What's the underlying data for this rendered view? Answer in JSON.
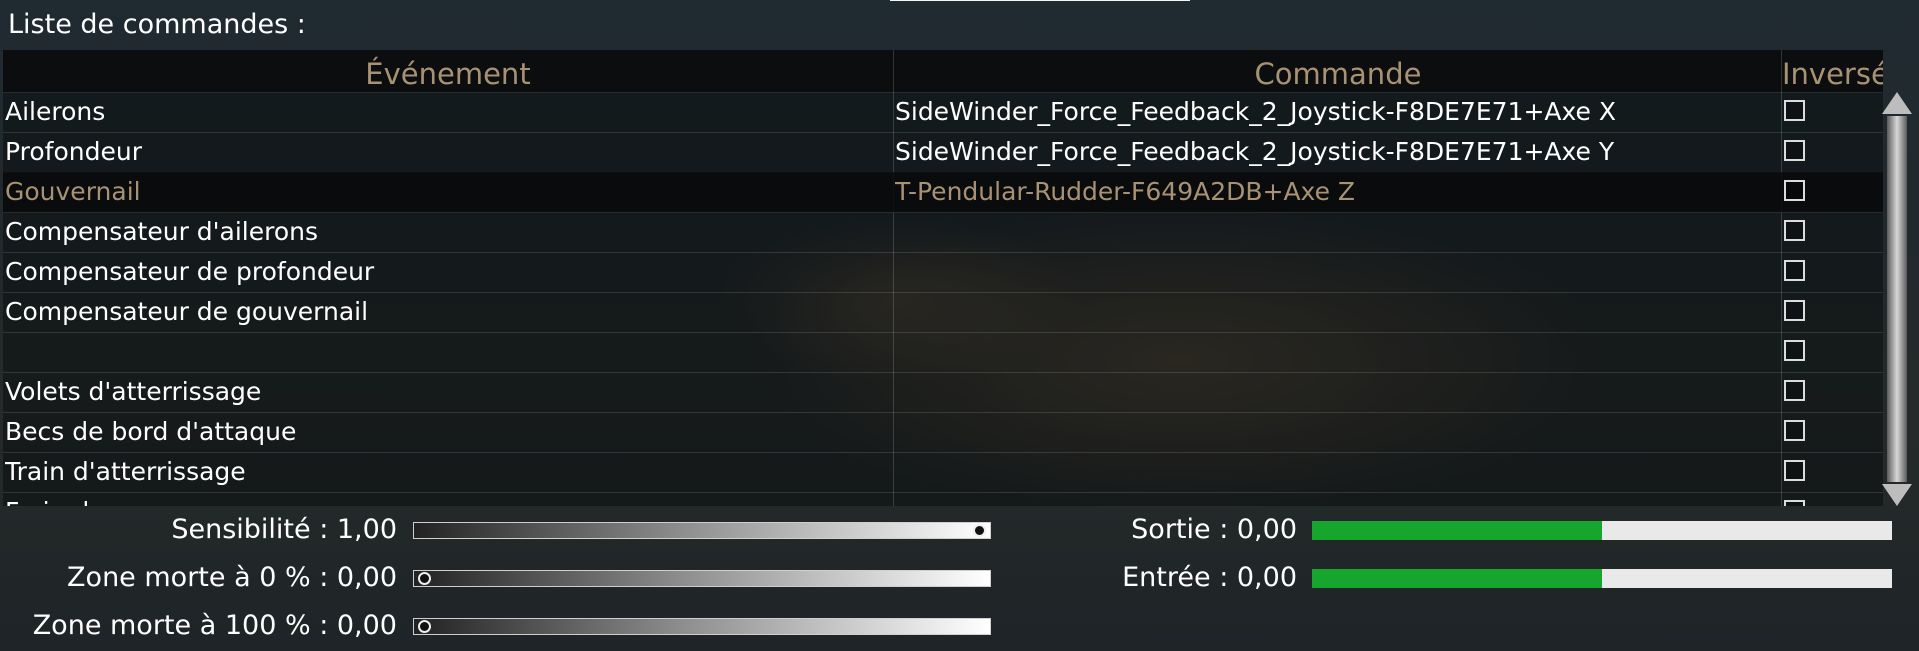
{
  "title": "Liste de commandes :",
  "columns": {
    "event": "Événement",
    "command": "Commande",
    "inverted": "Inversé"
  },
  "rows": [
    {
      "event": "Ailerons",
      "command": "SideWinder_Force_Feedback_2_Joystick-F8DE7E71+Axe X",
      "inverted": false,
      "selected": false
    },
    {
      "event": "Profondeur",
      "command": "SideWinder_Force_Feedback_2_Joystick-F8DE7E71+Axe Y",
      "inverted": false,
      "selected": false
    },
    {
      "event": "Gouvernail",
      "command": "T-Pendular-Rudder-F649A2DB+Axe Z",
      "inverted": false,
      "selected": true
    },
    {
      "event": "Compensateur d'ailerons",
      "command": "",
      "inverted": false,
      "selected": false
    },
    {
      "event": "Compensateur de profondeur",
      "command": "",
      "inverted": false,
      "selected": false
    },
    {
      "event": "Compensateur de gouvernail",
      "command": "",
      "inverted": false,
      "selected": false
    },
    {
      "event": "",
      "command": "",
      "inverted": false,
      "selected": false
    },
    {
      "event": "Volets d'atterrissage",
      "command": "",
      "inverted": false,
      "selected": false
    },
    {
      "event": "Becs de bord d'attaque",
      "command": "",
      "inverted": false,
      "selected": false
    },
    {
      "event": "Train d'atterrissage",
      "command": "",
      "inverted": false,
      "selected": false
    },
    {
      "event": "Frein de roue",
      "command": "",
      "inverted": false,
      "selected": false
    }
  ],
  "sliders": {
    "sensitivity": {
      "label": "Sensibilité : 1,00",
      "value": 1.0
    },
    "deadzone_0": {
      "label": "Zone morte à 0 % : 0,00",
      "value": 0.0
    },
    "deadzone_100": {
      "label": "Zone morte à 100 % : 0,00",
      "value": 0.0
    }
  },
  "meters": {
    "output": {
      "label": "Sortie : 0,00",
      "fill": 0.5
    },
    "input": {
      "label": "Entrée : 0,00",
      "fill": 0.5
    }
  },
  "colors": {
    "accent_text": "#a89274",
    "meter_green": "#16a62e"
  }
}
